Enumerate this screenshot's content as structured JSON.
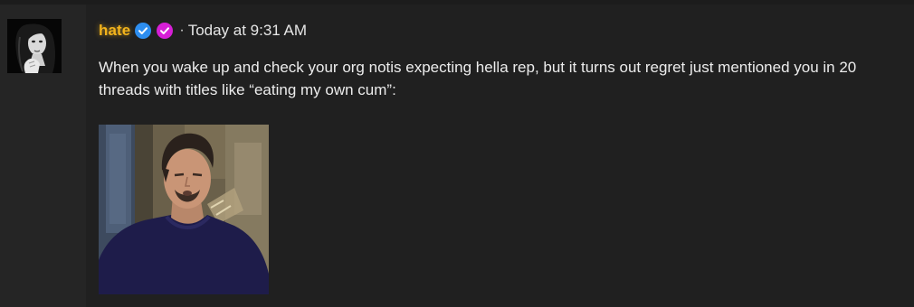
{
  "message": {
    "author": {
      "username": "hate",
      "name_color": "#f2b31c",
      "avatar_icon": "avatar-portrait",
      "badges": [
        {
          "icon": "verified-check-icon",
          "color": "#2d8ef0"
        },
        {
          "icon": "nitro-check-icon",
          "color": "#d61fd6"
        }
      ]
    },
    "separator": "·",
    "timestamp": "Today at 9:31 AM",
    "text": "When you wake up and check your org notis expecting hella rep, but it turns out regret just mentioned you in 20 threads with titles like “eating my own cum”:",
    "attachment": {
      "type": "gif",
      "description_icon": "reaction-gif-image"
    }
  }
}
